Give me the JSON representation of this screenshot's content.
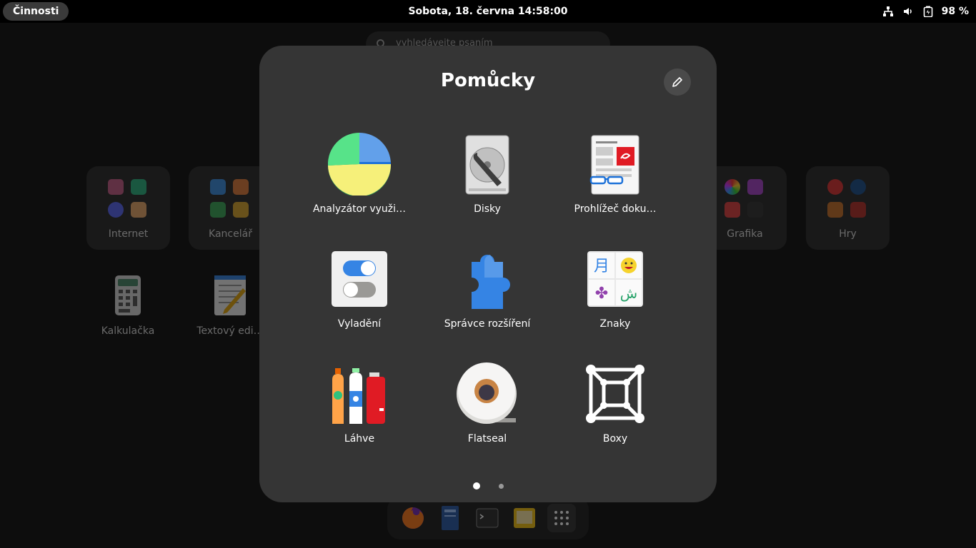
{
  "topbar": {
    "activities_label": "Činnosti",
    "clock": "Sobota, 18. června  14:58:00",
    "battery": "98 %"
  },
  "search": {
    "placeholder": "vyhledávejte psaním"
  },
  "background": {
    "folders": [
      {
        "label": "Internet"
      },
      {
        "label": "Kancelář"
      },
      {
        "label": "Grafika"
      },
      {
        "label": "Hry"
      }
    ],
    "apps": [
      {
        "label": "Kalkulačka"
      },
      {
        "label": "Textový edi…"
      }
    ]
  },
  "popup": {
    "title": "Pomůcky",
    "apps": [
      {
        "label": "Analyzátor využi…",
        "icon": "disk-usage-analyzer-icon"
      },
      {
        "label": "Disky",
        "icon": "disks-icon"
      },
      {
        "label": "Prohlížeč doku…",
        "icon": "document-viewer-icon"
      },
      {
        "label": "Vyladění",
        "icon": "tweaks-icon"
      },
      {
        "label": "Správce rozšíření",
        "icon": "extension-manager-icon"
      },
      {
        "label": "Znaky",
        "icon": "characters-icon"
      },
      {
        "label": "Láhve",
        "icon": "bottles-icon"
      },
      {
        "label": "Flatseal",
        "icon": "flatseal-icon"
      },
      {
        "label": "Boxy",
        "icon": "boxes-icon"
      }
    ],
    "pages": {
      "current": 1,
      "total": 2
    }
  },
  "dash": {
    "items": [
      "firefox-icon",
      "files-icon",
      "terminal-icon",
      "screenshot-icon",
      "app-grid-icon"
    ]
  }
}
